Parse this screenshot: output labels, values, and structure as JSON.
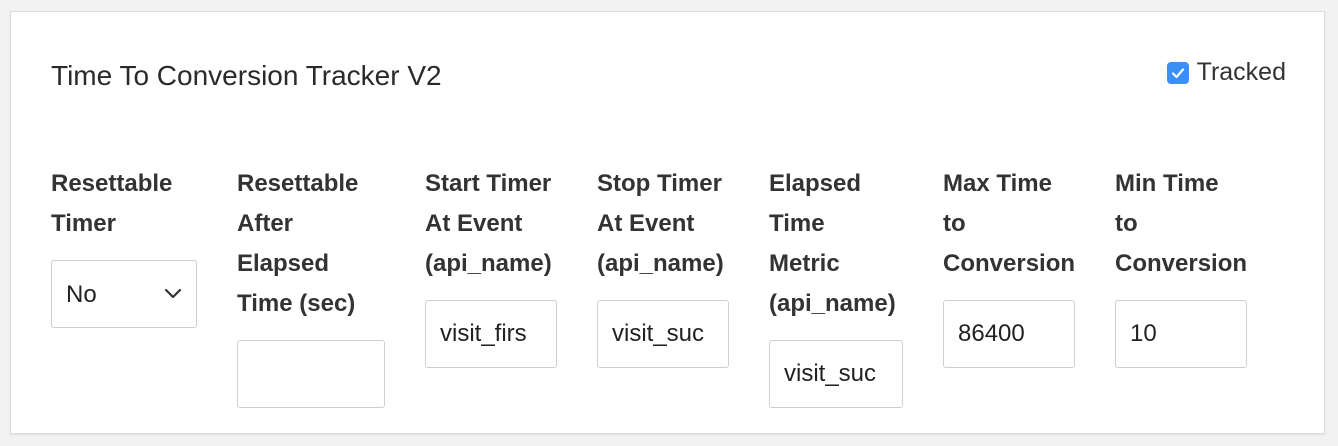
{
  "card": {
    "title": "Time To Conversion Tracker V2",
    "tracked_label": "Tracked",
    "tracked_checked": true
  },
  "fields": {
    "resettable_timer": {
      "label_lines": [
        "Resettable",
        "Timer"
      ],
      "value": "No"
    },
    "resettable_after": {
      "label_lines": [
        "Resettable",
        "After",
        "Elapsed",
        "Time (sec)"
      ],
      "value": ""
    },
    "start_timer": {
      "label_lines": [
        "Start Timer",
        "At Event",
        "(api_name)"
      ],
      "value": "visit_firs"
    },
    "stop_timer": {
      "label_lines": [
        "Stop Timer",
        "At Event",
        "(api_name)"
      ],
      "value": "visit_suc"
    },
    "elapsed_metric": {
      "label_lines": [
        "Elapsed",
        "Time",
        "Metric",
        "(api_name)"
      ],
      "value": "visit_suc"
    },
    "max_time": {
      "label_lines": [
        "Max Time",
        "to",
        "Conversion"
      ],
      "value": "86400"
    },
    "min_time": {
      "label_lines": [
        "Min Time",
        "to",
        "Conversion"
      ],
      "value": "10"
    }
  },
  "colors": {
    "checkbox": "#3b8ff5",
    "border": "#cfcfcf"
  },
  "icons": {
    "select_arrow": "chevron-down-icon",
    "checkbox": "check-icon"
  }
}
